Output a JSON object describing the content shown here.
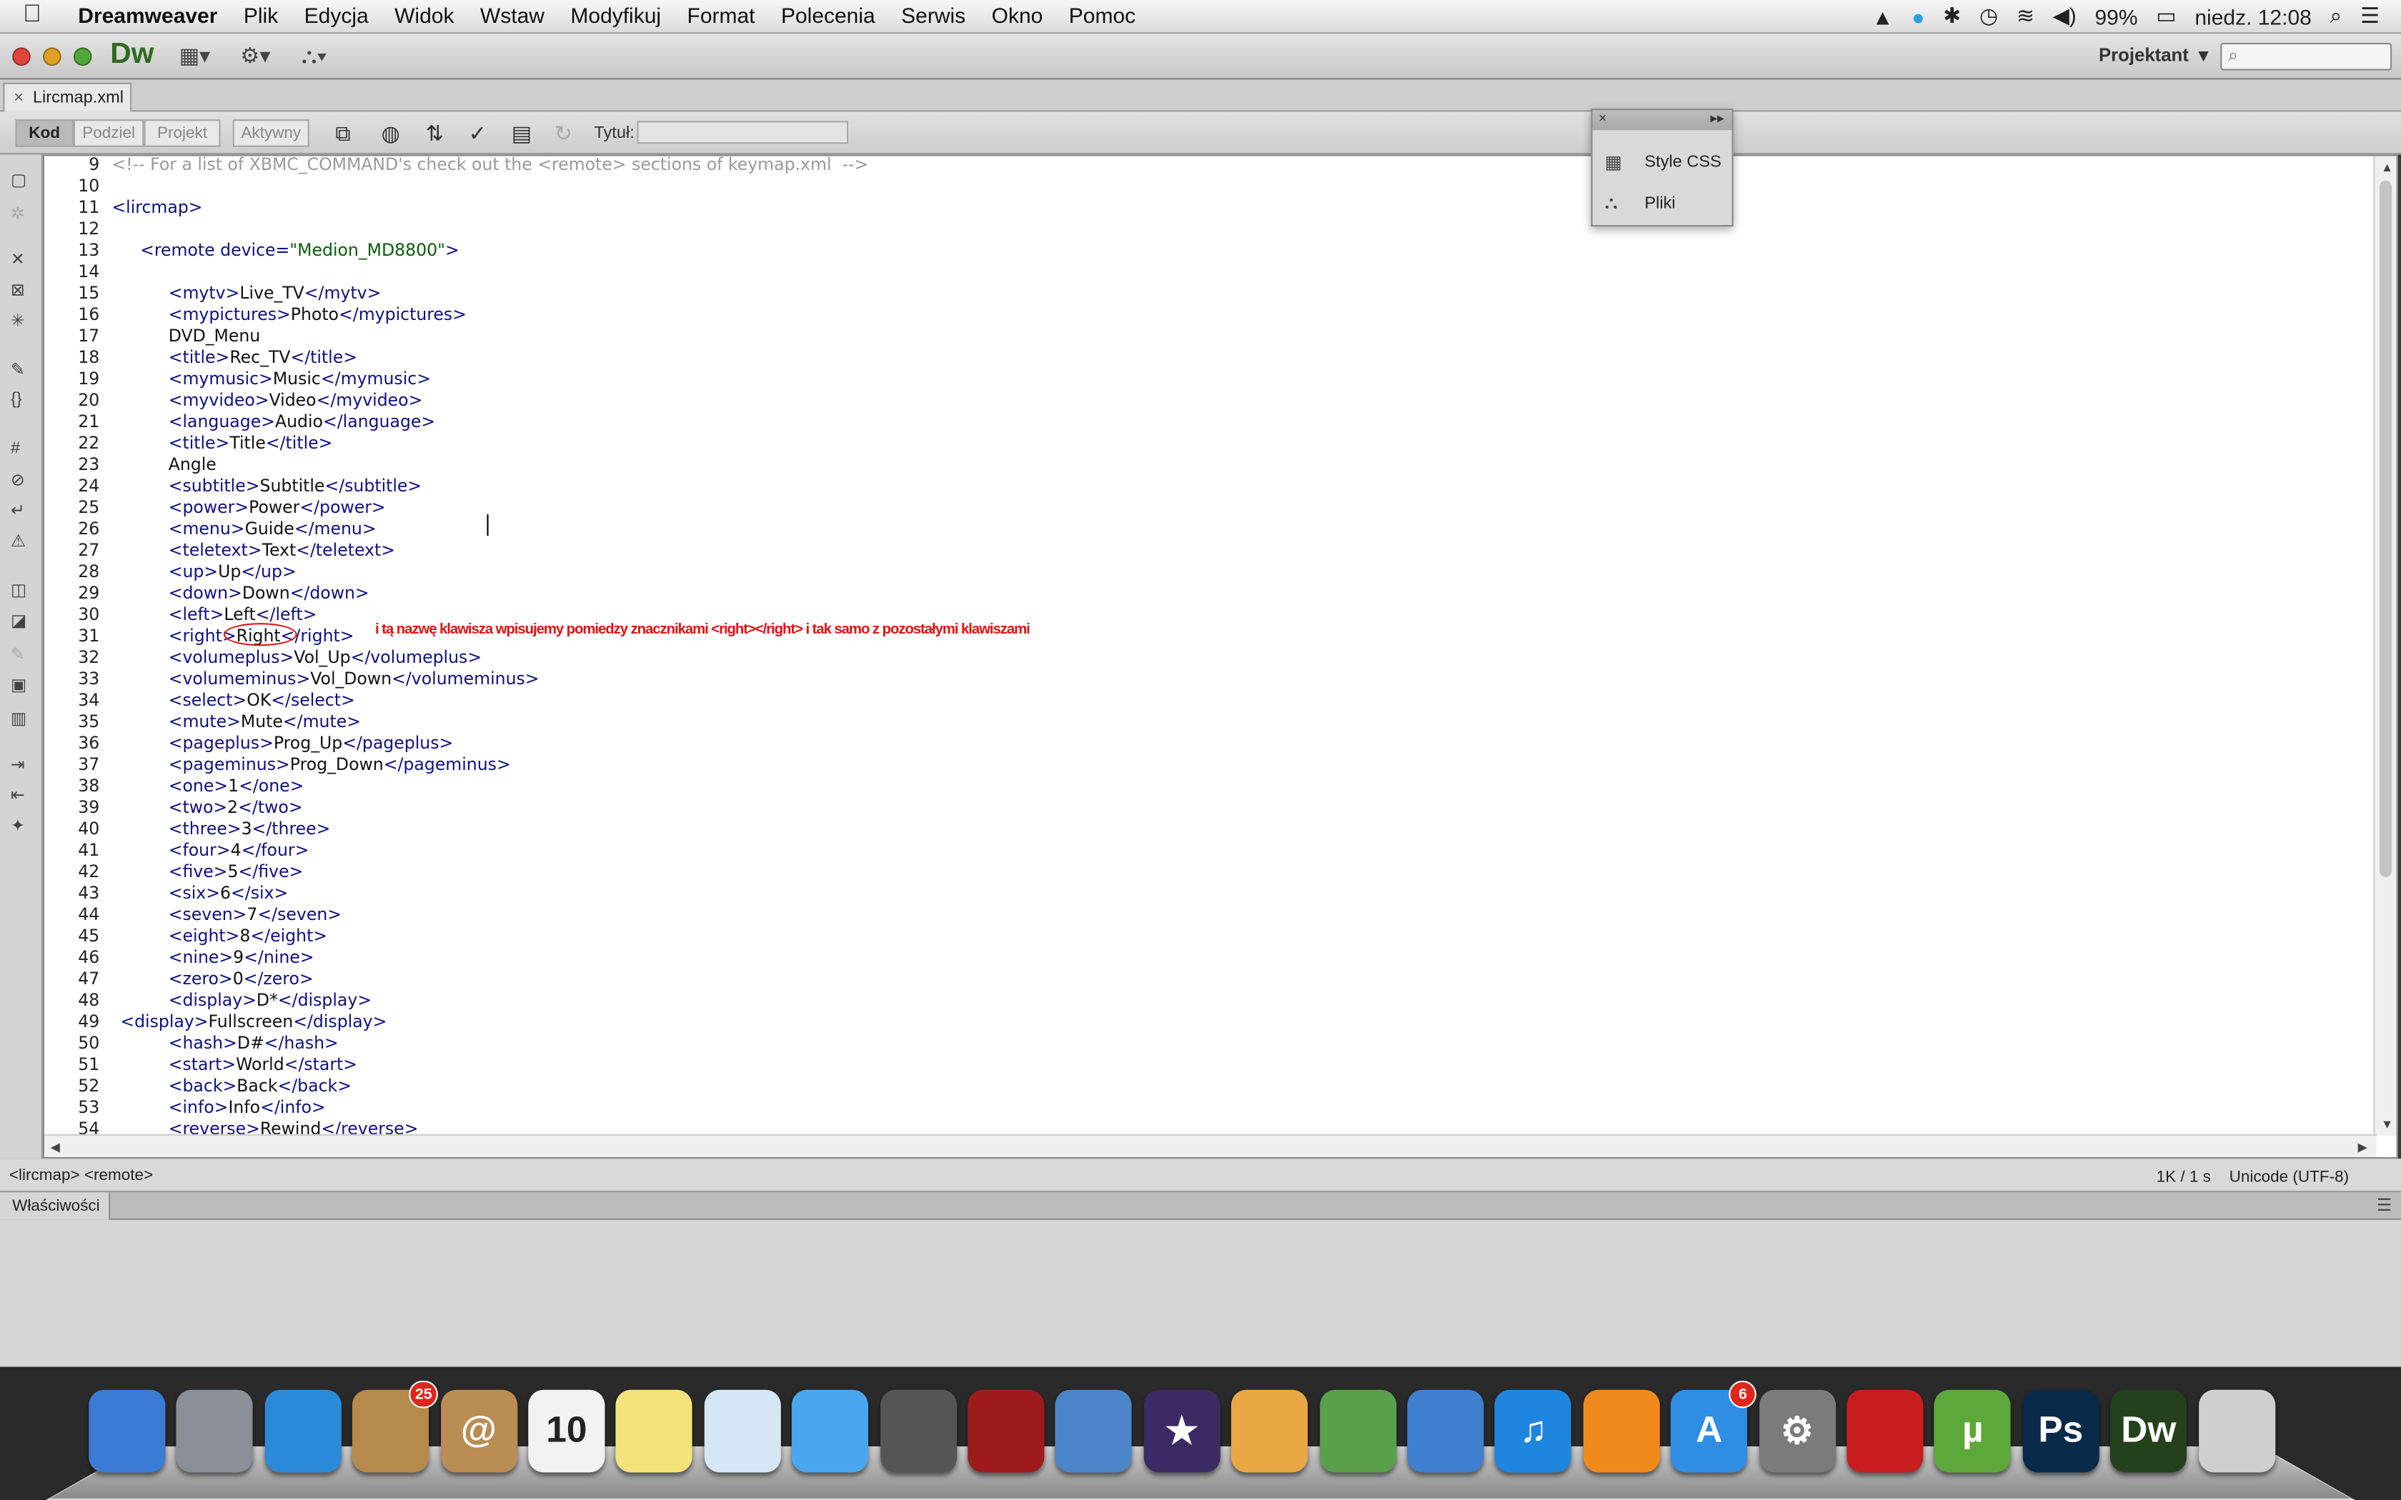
{
  "menubar": {
    "items": [
      "Dreamweaver",
      "Plik",
      "Edycja",
      "Widok",
      "Wstaw",
      "Modyfikuj",
      "Format",
      "Polecenia",
      "Serwis",
      "Okno",
      "Pomoc"
    ],
    "battery": "99%",
    "clock": "niedz. 12:08"
  },
  "appbar": {
    "logo": "Dw",
    "workspace": "Projektant",
    "search_placeholder": ""
  },
  "tab": {
    "filename": "Lircmap.xml"
  },
  "toolbar": {
    "views": [
      "Kod",
      "Podziel",
      "Projekt",
      "Aktywny"
    ],
    "title_label": "Tytuł:",
    "title_value": ""
  },
  "floating_panel": {
    "items": [
      "Style CSS",
      "Pliki"
    ]
  },
  "editor": {
    "lines": [
      {
        "n": "9",
        "indent": 0,
        "cls": "cm",
        "text": "<!-- For a list of XBMC_COMMAND's check out the <remote> sections of keymap.xml  -->"
      },
      {
        "n": "10",
        "indent": 0,
        "text": ""
      },
      {
        "n": "11",
        "indent": 0,
        "open": "<lircmap>",
        "inner": "",
        "close": ""
      },
      {
        "n": "12",
        "indent": 0,
        "text": ""
      },
      {
        "n": "13",
        "indent": 1,
        "open": "<remote device=",
        "val": "\"Medion_MD8800\"",
        "close": ">"
      },
      {
        "n": "14",
        "indent": 0,
        "text": ""
      },
      {
        "n": "15",
        "indent": 2,
        "open": "<mytv>",
        "inner": "Live_TV",
        "close": "</mytv>"
      },
      {
        "n": "16",
        "indent": 2,
        "open": "<mypictures>",
        "inner": "Photo",
        "close": "</mypictures>"
      },
      {
        "n": "17",
        "indent": 2,
        "plain": "DVD_Menu"
      },
      {
        "n": "18",
        "indent": 2,
        "open": "<title>",
        "inner": "Rec_TV",
        "close": "</title>"
      },
      {
        "n": "19",
        "indent": 2,
        "open": "<mymusic>",
        "inner": "Music",
        "close": "</mymusic>"
      },
      {
        "n": "20",
        "indent": 2,
        "open": "<myvideo>",
        "inner": "Video",
        "close": "</myvideo>"
      },
      {
        "n": "21",
        "indent": 2,
        "open": "<language>",
        "inner": "Audio",
        "close": "</language>"
      },
      {
        "n": "22",
        "indent": 2,
        "open": "<title>",
        "inner": "Title",
        "close": "</title>"
      },
      {
        "n": "23",
        "indent": 2,
        "plain": "Angle"
      },
      {
        "n": "24",
        "indent": 2,
        "open": "<subtitle>",
        "inner": "Subtitle",
        "close": "</subtitle>"
      },
      {
        "n": "25",
        "indent": 2,
        "open": "<power>",
        "inner": "Power",
        "close": "</power>"
      },
      {
        "n": "26",
        "indent": 2,
        "open": "<menu>",
        "inner": "Guide",
        "close": "</menu>"
      },
      {
        "n": "27",
        "indent": 2,
        "open": "<teletext>",
        "inner": "Text",
        "close": "</teletext>"
      },
      {
        "n": "28",
        "indent": 2,
        "open": "<up>",
        "inner": "Up",
        "close": "</up>"
      },
      {
        "n": "29",
        "indent": 2,
        "open": "<down>",
        "inner": "Down",
        "close": "</down>"
      },
      {
        "n": "30",
        "indent": 2,
        "open": "<left>",
        "inner": "Left",
        "close": "</left>"
      },
      {
        "n": "31",
        "indent": 2,
        "open": "<right>",
        "inner": "Right",
        "close": "</right>"
      },
      {
        "n": "32",
        "indent": 2,
        "open": "<volumeplus>",
        "inner": "Vol_Up",
        "close": "</volumeplus>"
      },
      {
        "n": "33",
        "indent": 2,
        "open": "<volumeminus>",
        "inner": "Vol_Down",
        "close": "</volumeminus>"
      },
      {
        "n": "34",
        "indent": 2,
        "open": "<select>",
        "inner": "OK",
        "close": "</select>"
      },
      {
        "n": "35",
        "indent": 2,
        "open": "<mute>",
        "inner": "Mute",
        "close": "</mute>"
      },
      {
        "n": "36",
        "indent": 2,
        "open": "<pageplus>",
        "inner": "Prog_Up",
        "close": "</pageplus>"
      },
      {
        "n": "37",
        "indent": 2,
        "open": "<pageminus>",
        "inner": "Prog_Down",
        "close": "</pageminus>"
      },
      {
        "n": "38",
        "indent": 2,
        "open": "<one>",
        "inner": "1",
        "close": "</one>"
      },
      {
        "n": "39",
        "indent": 2,
        "open": "<two>",
        "inner": "2",
        "close": "</two>"
      },
      {
        "n": "40",
        "indent": 2,
        "open": "<three>",
        "inner": "3",
        "close": "</three>"
      },
      {
        "n": "41",
        "indent": 2,
        "open": "<four>",
        "inner": "4",
        "close": "</four>"
      },
      {
        "n": "42",
        "indent": 2,
        "open": "<five>",
        "inner": "5",
        "close": "</five>"
      },
      {
        "n": "43",
        "indent": 2,
        "open": "<six>",
        "inner": "6",
        "close": "</six>"
      },
      {
        "n": "44",
        "indent": 2,
        "open": "<seven>",
        "inner": "7",
        "close": "</seven>"
      },
      {
        "n": "45",
        "indent": 2,
        "open": "<eight>",
        "inner": "8",
        "close": "</eight>"
      },
      {
        "n": "46",
        "indent": 2,
        "open": "<nine>",
        "inner": "9",
        "close": "</nine>"
      },
      {
        "n": "47",
        "indent": 2,
        "open": "<zero>",
        "inner": "0",
        "close": "</zero>"
      },
      {
        "n": "48",
        "indent": 2,
        "open": "<display>",
        "inner": "D*",
        "close": "</display>"
      },
      {
        "n": "49",
        "indent": 0.3,
        "open": "<display>",
        "inner": "Fullscreen",
        "close": "</display>"
      },
      {
        "n": "50",
        "indent": 2,
        "open": "<hash>",
        "inner": "D#",
        "close": "</hash>"
      },
      {
        "n": "51",
        "indent": 2,
        "open": "<start>",
        "inner": "World",
        "close": "</start>"
      },
      {
        "n": "52",
        "indent": 2,
        "open": "<back>",
        "inner": "Back",
        "close": "</back>"
      },
      {
        "n": "53",
        "indent": 2,
        "open": "<info>",
        "inner": "Info",
        "close": "</info>"
      },
      {
        "n": "54",
        "indent": 2,
        "open": "<reverse>",
        "inner": "Rewind",
        "close": "</reverse>"
      }
    ],
    "annotation": "i tą nazwę klawisza wpisujemy pomiedzy znacznikami <right></right> i tak samo z pozostałymi klawiszami"
  },
  "statusbar": {
    "tag_selector": "<lircmap> <remote>",
    "size": "1K / 1 s",
    "encoding": "Unicode (UTF-8)"
  },
  "properties": {
    "title": "Właściwości"
  },
  "dock": {
    "apps": [
      {
        "name": "finder-icon",
        "label": "",
        "color": "#3a7bd5",
        "badge": ""
      },
      {
        "name": "launchpad-icon",
        "label": "",
        "color": "#8a8f98",
        "badge": ""
      },
      {
        "name": "safari-icon",
        "label": "",
        "color": "#2b8ad8",
        "badge": ""
      },
      {
        "name": "mail-icon",
        "label": "",
        "color": "#b58a4a",
        "badge": "25"
      },
      {
        "name": "contacts-icon",
        "label": "@",
        "color": "#b98d54",
        "badge": ""
      },
      {
        "name": "calendar-icon",
        "label": "10",
        "color": "#f2f2f2",
        "badge": ""
      },
      {
        "name": "notes-icon",
        "label": "",
        "color": "#f3e37a",
        "badge": ""
      },
      {
        "name": "preview-icon",
        "label": "",
        "color": "#d7e6f5",
        "badge": ""
      },
      {
        "name": "messages-icon",
        "label": "",
        "color": "#4aa7ef",
        "badge": ""
      },
      {
        "name": "facetime-icon",
        "label": "",
        "color": "#555",
        "badge": ""
      },
      {
        "name": "photobooth-icon",
        "label": "",
        "color": "#9e1b1b",
        "badge": ""
      },
      {
        "name": "iphoto-icon",
        "label": "",
        "color": "#4a86c8",
        "badge": ""
      },
      {
        "name": "imovie-icon",
        "label": "★",
        "color": "#3b2a63",
        "badge": ""
      },
      {
        "name": "pages-icon",
        "label": "",
        "color": "#e9a844",
        "badge": ""
      },
      {
        "name": "numbers-icon",
        "label": "",
        "color": "#5aa04a",
        "badge": ""
      },
      {
        "name": "keynote-icon",
        "label": "",
        "color": "#3f7fd0",
        "badge": ""
      },
      {
        "name": "itunes-icon",
        "label": "♫",
        "color": "#1f86e0",
        "badge": ""
      },
      {
        "name": "ibooks-icon",
        "label": "",
        "color": "#f08a1c",
        "badge": ""
      },
      {
        "name": "appstore-icon",
        "label": "A",
        "color": "#2f8de4",
        "badge": "6"
      },
      {
        "name": "system-prefs-icon",
        "label": "⚙",
        "color": "#7b7b7b",
        "badge": ""
      },
      {
        "name": "acrobat-icon",
        "label": "",
        "color": "#c81d1d",
        "badge": ""
      },
      {
        "name": "utorrent-icon",
        "label": "µ",
        "color": "#5da83a",
        "badge": ""
      },
      {
        "name": "photoshop-icon",
        "label": "Ps",
        "color": "#0a2a4a",
        "badge": ""
      },
      {
        "name": "dreamweaver-icon",
        "label": "Dw",
        "color": "#23411a",
        "badge": ""
      },
      {
        "name": "trash-icon",
        "label": "",
        "color": "#cfcfcf",
        "badge": ""
      }
    ]
  }
}
